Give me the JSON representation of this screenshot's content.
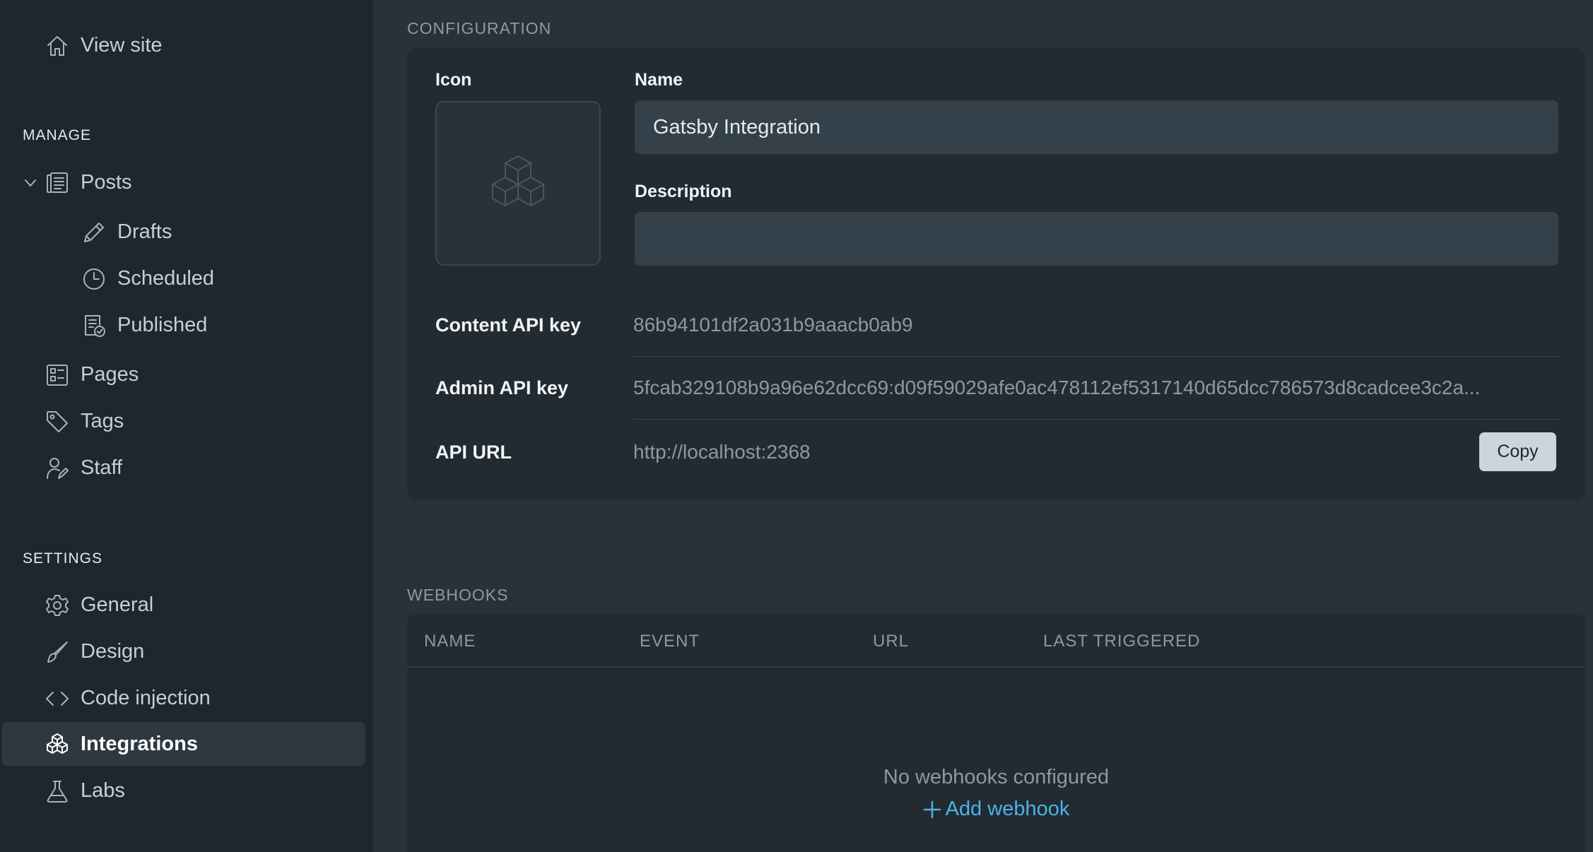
{
  "sidebar": {
    "view_site": "View site",
    "manage_heading": "MANAGE",
    "posts": "Posts",
    "drafts": "Drafts",
    "scheduled": "Scheduled",
    "published": "Published",
    "pages": "Pages",
    "tags": "Tags",
    "staff": "Staff",
    "settings_heading": "SETTINGS",
    "general": "General",
    "design": "Design",
    "code_injection": "Code injection",
    "integrations": "Integrations",
    "labs": "Labs"
  },
  "configuration": {
    "heading": "CONFIGURATION",
    "icon_label": "Icon",
    "name_label": "Name",
    "name_value": "Gatsby Integration",
    "description_label": "Description",
    "description_value": "",
    "content_api_key_label": "Content API key",
    "content_api_key_value": "86b94101df2a031b9aaacb0ab9",
    "admin_api_key_label": "Admin API key",
    "admin_api_key_value": "5fcab329108b9a96e62dcc69:d09f59029afe0ac478112ef5317140d65dcc786573d8cadcee3c2a...",
    "api_url_label": "API URL",
    "api_url_value": "http://localhost:2368",
    "copy_label": "Copy"
  },
  "webhooks": {
    "heading": "WEBHOOKS",
    "columns": [
      "NAME",
      "EVENT",
      "URL",
      "LAST TRIGGERED"
    ],
    "empty_message": "No webhooks configured",
    "add_label": "Add webhook"
  },
  "colors": {
    "accent": "#4bb3e6",
    "sidebar_bg": "#1f272e",
    "main_bg": "#28323a"
  }
}
